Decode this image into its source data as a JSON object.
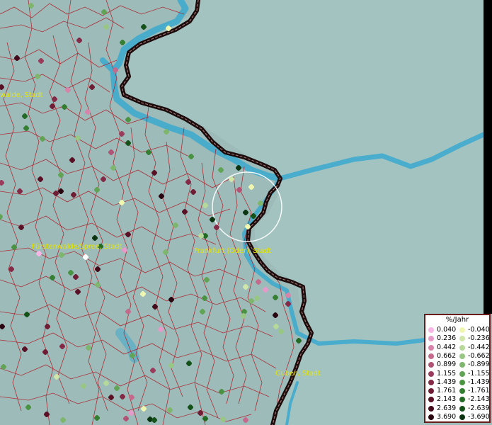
{
  "labels": {
    "fuerstenwalde_partial": "walde, Stadt",
    "fuerstenwalde_spree": "Fürstenwalde/Spree, Stadt",
    "frankfurt_oder": "Frankfurt (Oder), Stadt",
    "guben": "Guben, Stadt"
  },
  "legend": {
    "title": "%/Jahr",
    "rows": [
      {
        "pos": "0.040",
        "neg": "-0.040",
        "pos_color": "#f7b6e6",
        "neg_color": "#eef6b0"
      },
      {
        "pos": "0.236",
        "neg": "-0.236",
        "pos_color": "#e69ac9",
        "neg_color": "#cfe6a8"
      },
      {
        "pos": "0.442",
        "neg": "-0.442",
        "pos_color": "#d883aa",
        "neg_color": "#b6d99a"
      },
      {
        "pos": "0.662",
        "neg": "-0.662",
        "pos_color": "#c56a8d",
        "neg_color": "#98c784"
      },
      {
        "pos": "0.899",
        "neg": "-0.899",
        "pos_color": "#b25274",
        "neg_color": "#7db66c"
      },
      {
        "pos": "1.155",
        "neg": "-1.155",
        "pos_color": "#9b3c5c",
        "neg_color": "#62a455"
      },
      {
        "pos": "1.439",
        "neg": "-1.439",
        "pos_color": "#852a46",
        "neg_color": "#4a9342"
      },
      {
        "pos": "1.761",
        "neg": "-1.761",
        "pos_color": "#701c34",
        "neg_color": "#357f33"
      },
      {
        "pos": "2.143",
        "neg": "-2.143",
        "pos_color": "#5a1126",
        "neg_color": "#236a25"
      },
      {
        "pos": "2.639",
        "neg": "-2.639",
        "pos_color": "#430a1a",
        "neg_color": "#155219"
      },
      {
        "pos": "3.690",
        "neg": "-3.690",
        "pos_color": "#2a0510",
        "neg_color": "#0a3510"
      }
    ]
  },
  "colors": {
    "land": "#9dbcba",
    "land_east": "#a2c2bf",
    "water": "#3aa9cf",
    "border": "#b0202a",
    "country_border": "#1a0a0a",
    "label": "#e6e600"
  }
}
